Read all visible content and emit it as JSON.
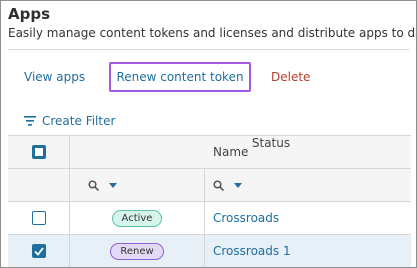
{
  "header": {
    "title": "Apps",
    "subtitle": "Easily manage content tokens and licenses and distribute apps to devices."
  },
  "actions": {
    "view_apps": "View apps",
    "renew_token": "Renew content token",
    "delete": "Delete"
  },
  "filter": {
    "create_label": "Create Filter"
  },
  "table": {
    "columns": {
      "status": "Status",
      "name": "Name"
    },
    "rows": [
      {
        "status": "Active",
        "name": "Crossroads",
        "selected": false
      },
      {
        "status": "Renew",
        "name": "Crossroads 1",
        "selected": true
      }
    ]
  },
  "colors": {
    "link": "#1f6f9f",
    "delete": "#b3402f",
    "highlight": "#a259e0",
    "active_badge": "#d7f4ec",
    "renew_badge": "#e3d9f5"
  }
}
